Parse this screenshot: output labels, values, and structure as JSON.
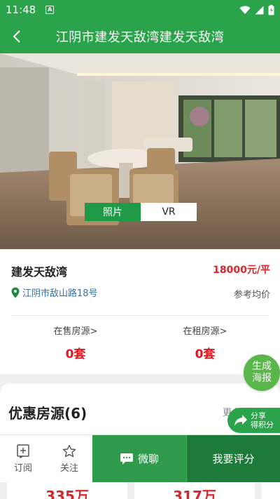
{
  "status_bar": {
    "time": "11:48",
    "notification_glyph": "A"
  },
  "header": {
    "title": "江阴市建发天敌湾建发天敌湾"
  },
  "gallery": {
    "tabs": [
      {
        "label": "照片",
        "active": true
      },
      {
        "label": "VR",
        "active": false
      }
    ],
    "dot_count": 10,
    "active_dot": 8
  },
  "property": {
    "name": "建发天敌湾",
    "price": "18000元/平",
    "address": "江阴市敌山路18号",
    "price_note": "参考均价",
    "stats": [
      {
        "label": "在售房源>",
        "value": "0套"
      },
      {
        "label": "在租房源>",
        "value": "0套"
      }
    ]
  },
  "deals": {
    "title": "优惠房源(6)",
    "more": "更多优惠"
  },
  "floating": {
    "poster_line1": "生成",
    "poster_line2": "海报",
    "share_line1": "分享",
    "share_line2": "得积分"
  },
  "bottom_bar": {
    "subscribe": "订阅",
    "follow": "关注",
    "chat": "微聊",
    "review": "我要评分"
  },
  "listings": [
    {
      "price": "335万"
    },
    {
      "price": "317万"
    }
  ],
  "colors": {
    "brand_green": "#2aa34a",
    "price_red": "#d9262c",
    "link_blue": "#3a6fa8"
  }
}
